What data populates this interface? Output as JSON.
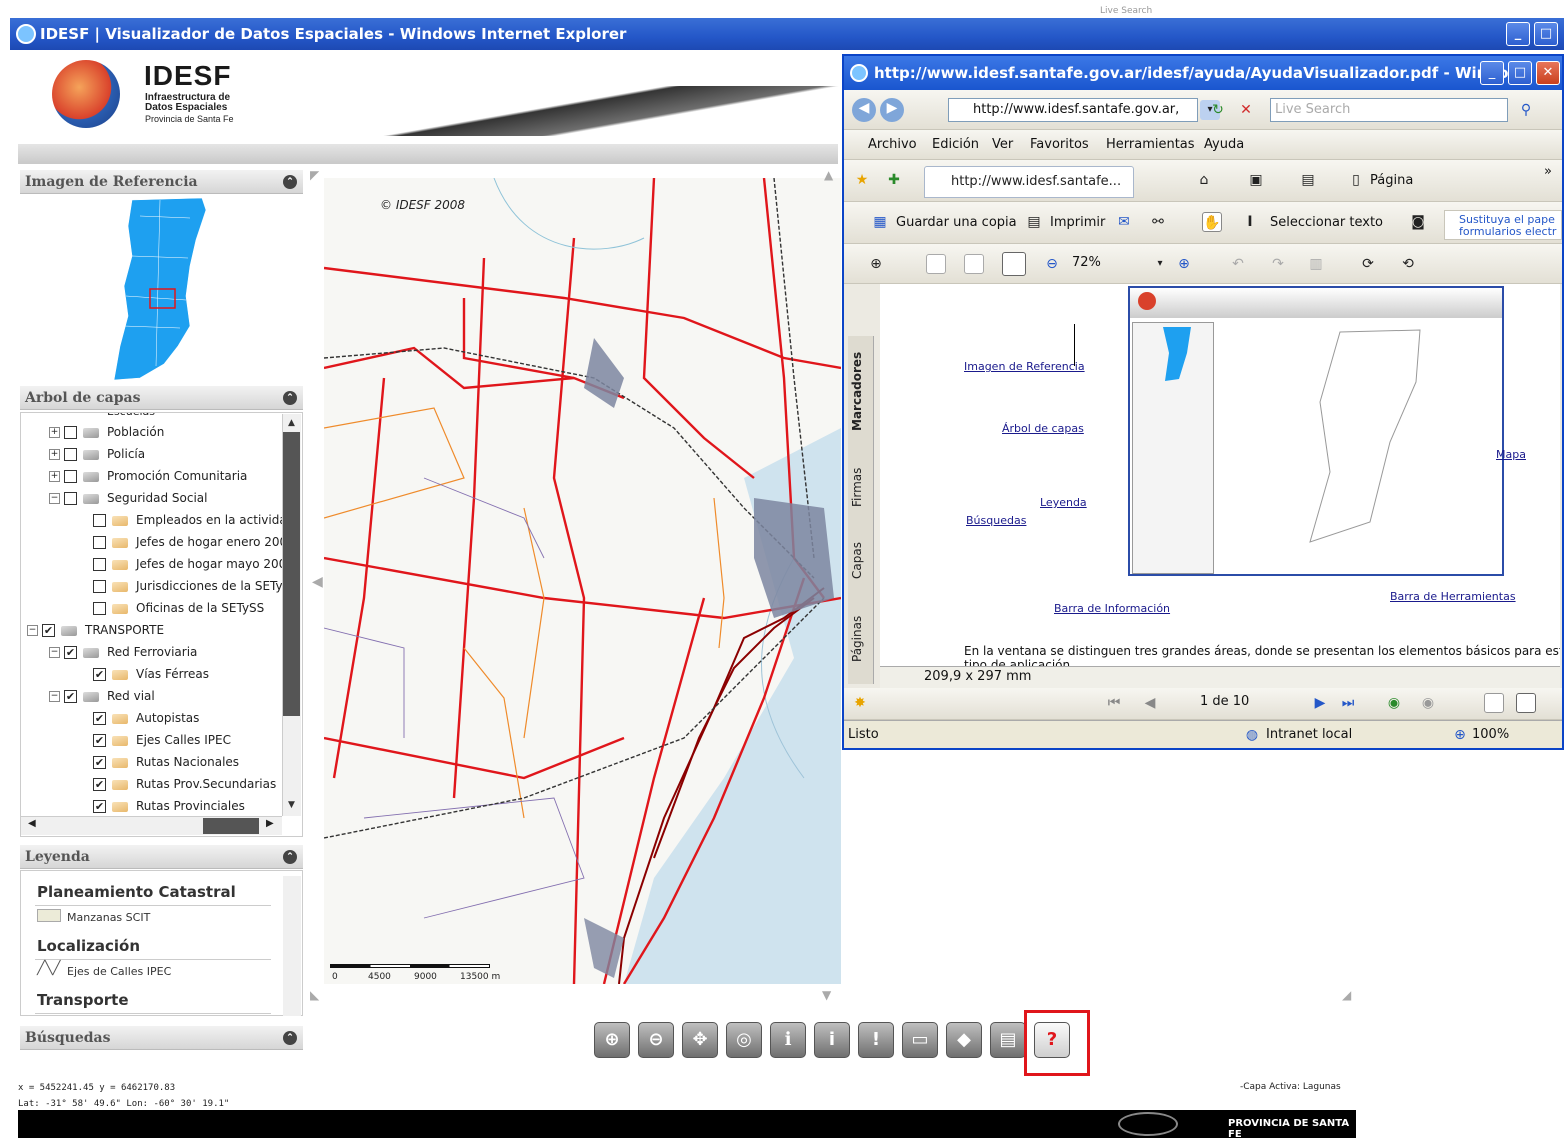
{
  "main_window": {
    "title": "IDESF | Visualizador de Datos Espaciales - Windows Internet Explorer",
    "top_search_fragment": "Live Search"
  },
  "header": {
    "logo_text": "IDESF",
    "subtitle_line1": "Infraestructura de",
    "subtitle_line2": "Datos Espaciales",
    "subtitle_line3": "Provincia de Santa Fe"
  },
  "panels": {
    "reference": "Imagen de Referencia",
    "layers": "Arbol de capas",
    "legend": "Leyenda",
    "search": "Búsquedas"
  },
  "tree": {
    "clipped_top": "Escuelas",
    "rows": [
      {
        "label": "Población",
        "checked": false,
        "expander": "+"
      },
      {
        "label": "Policía",
        "checked": false,
        "expander": "+"
      },
      {
        "label": "Promoción Comunitaria",
        "checked": false,
        "expander": "+"
      },
      {
        "label": "Seguridad Social",
        "checked": false,
        "expander": "−"
      },
      {
        "label": "Empleados en la activida",
        "checked": false,
        "expander": ""
      },
      {
        "label": "Jefes de hogar enero 200",
        "checked": false,
        "expander": ""
      },
      {
        "label": "Jefes de hogar mayo 200",
        "checked": false,
        "expander": ""
      },
      {
        "label": "Jurisdicciones de la SETy",
        "checked": false,
        "expander": ""
      },
      {
        "label": "Oficinas de la SETySS",
        "checked": false,
        "expander": ""
      },
      {
        "label": "TRANSPORTE",
        "checked": true,
        "expander": "−"
      },
      {
        "label": "Red Ferroviaria",
        "checked": true,
        "expander": "−"
      },
      {
        "label": "Vías Férreas",
        "checked": true,
        "expander": ""
      },
      {
        "label": "Red vial",
        "checked": true,
        "expander": "−"
      },
      {
        "label": "Autopistas",
        "checked": true,
        "expander": ""
      },
      {
        "label": "Ejes Calles IPEC",
        "checked": true,
        "expander": ""
      },
      {
        "label": "Rutas Nacionales",
        "checked": true,
        "expander": ""
      },
      {
        "label": "Rutas Prov.Secundarias",
        "checked": true,
        "expander": ""
      },
      {
        "label": "Rutas Provinciales",
        "checked": true,
        "expander": ""
      }
    ]
  },
  "legend": {
    "groups": [
      {
        "title": "Planeamiento Catastral",
        "item": "Manzanas SCIT"
      },
      {
        "title": "Localización",
        "item": "Ejes de Calles IPEC"
      },
      {
        "title": "Transporte",
        "item": ""
      }
    ]
  },
  "map": {
    "copyright": "© IDESF 2008",
    "scale_labels": [
      "0",
      "4500",
      "9000",
      "13500 m"
    ]
  },
  "status": {
    "coords_line1": "x = 5452241.45 y = 6462170.83",
    "coords_line2": "Lat: -31° 58' 49.6\" Lon: -60° 30' 19.1\"",
    "active_layer": "-Capa Activa: Lagunas",
    "footer": "PROVINCIA DE SANTA FE"
  },
  "pdf_window": {
    "title": "http://www.idesf.santafe.gov.ar/idesf/ayuda/AyudaVisualizador.pdf - Windo...",
    "address": "http://www.idesf.santafe.gov.ar,",
    "search_placeholder": "Live Search",
    "menu": [
      "Archivo",
      "Edición",
      "Ver",
      "Favoritos",
      "Herramientas",
      "Ayuda"
    ],
    "tab": "http://www.idesf.santafe...",
    "page_menu": "Página",
    "save_copy": "Guardar una copia",
    "print": "Imprimir",
    "select_text": "Seleccionar texto",
    "promo_line1": "Sustituya el pape",
    "promo_line2": "formularios electr",
    "zoom": "72%",
    "side_tabs": [
      "Marcadores",
      "Firmas",
      "Capas",
      "Páginas"
    ],
    "doc_links": {
      "ref": "Imagen de Referencia",
      "arbol": "Árbol de capas",
      "leyenda": "Leyenda",
      "busquedas": "Búsquedas",
      "mapa": "Mapa",
      "info": "Barra de Información",
      "herr": "Barra de Herramientas"
    },
    "doc_text": "En la ventana se distinguen tres grandes áreas, donde se presentan los elementos básicos para este",
    "doc_text2": "tipo de aplicación",
    "page_size": "209,9 x 297 mm",
    "page_counter": "1 de 10",
    "status_left": "Listo",
    "status_zone": "Intranet local",
    "status_zoom": "100%"
  },
  "colors": {
    "titlebar": "#2457c8",
    "road": "#e0161b",
    "water": "#cfe3ee"
  }
}
